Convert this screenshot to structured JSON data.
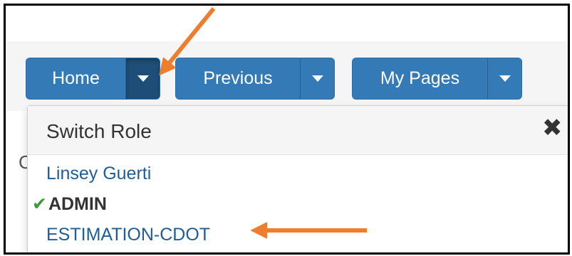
{
  "toolbar": {
    "home_label": "Home",
    "previous_label": "Previous",
    "my_pages_label": "My Pages"
  },
  "dropdown": {
    "title": "Switch Role",
    "close_icon": "close-x-icon",
    "roles": [
      {
        "label": "Linsey Guerti",
        "current": false
      },
      {
        "label": "ADMIN",
        "current": true
      },
      {
        "label": "ESTIMATION-CDOT",
        "current": false
      }
    ]
  },
  "peek_text": "C",
  "colors": {
    "button_blue": "#337ab7",
    "button_active": "#1e4e78",
    "link_blue": "#1f5d97",
    "check_green": "#3c9a3c",
    "annotation_arrow": "#ef7d2e"
  },
  "annotations": [
    {
      "type": "arrow",
      "points_to": "home-dropdown-caret"
    },
    {
      "type": "arrow",
      "points_to": "role-estimation-cdot"
    }
  ]
}
